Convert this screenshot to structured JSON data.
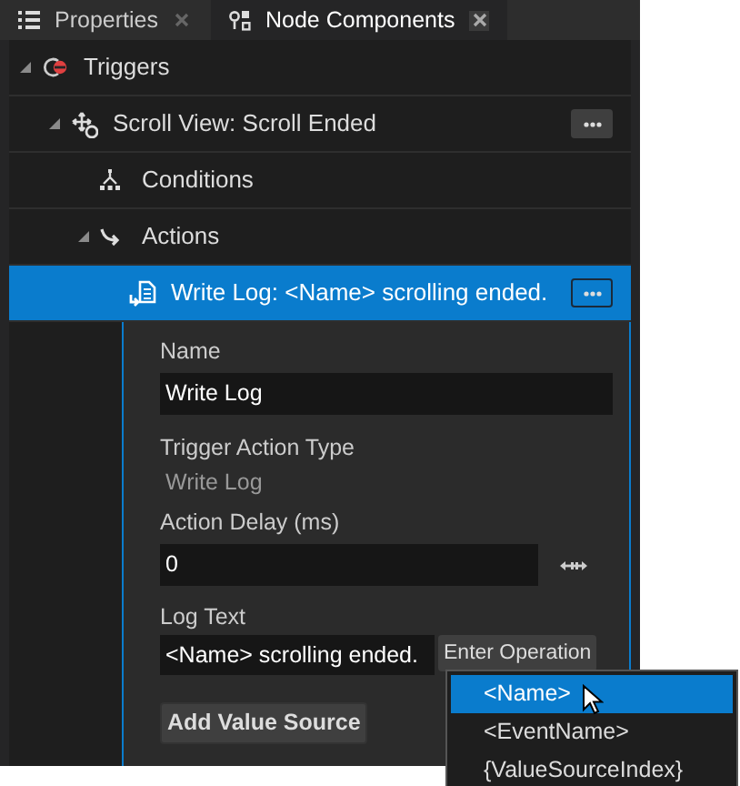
{
  "tabs": [
    {
      "label": "Properties",
      "selected": false,
      "kind": "list"
    },
    {
      "label": "Node Components",
      "selected": true,
      "kind": "components"
    }
  ],
  "tree": [
    {
      "label": "Triggers",
      "kind": "trigger",
      "expanded": true,
      "children": [
        {
          "label": "Scroll View: Scroll Ended",
          "kind": "scroll-event",
          "expanded": true,
          "menu_button": true,
          "children": [
            {
              "label": "Conditions",
              "kind": "conditions"
            },
            {
              "label": "Actions",
              "kind": "actions",
              "expanded": true,
              "children": [
                {
                  "label": "Write Log: <Name> scrolling ended.",
                  "kind": "write-log",
                  "selected": true,
                  "menu_button": true
                }
              ]
            }
          ]
        }
      ]
    }
  ],
  "details": {
    "fields": [
      {
        "kind": "input",
        "label": "Name",
        "value": "Write Log"
      },
      {
        "kind": "readonly",
        "label": "Trigger Action Type",
        "value": "Write Log"
      },
      {
        "kind": "number",
        "label": "Action Delay (ms)",
        "value": "0"
      },
      {
        "kind": "operation",
        "label": "Log Text",
        "value": "<Name> scrolling ended.",
        "button": "Enter Operation"
      }
    ],
    "add_button": "Add Value Source"
  },
  "menu": [
    {
      "label": "<Name>",
      "selected": true
    },
    {
      "label": "<EventName>",
      "selected": false
    },
    {
      "label": "{ValueSourceIndex}",
      "selected": false
    }
  ]
}
